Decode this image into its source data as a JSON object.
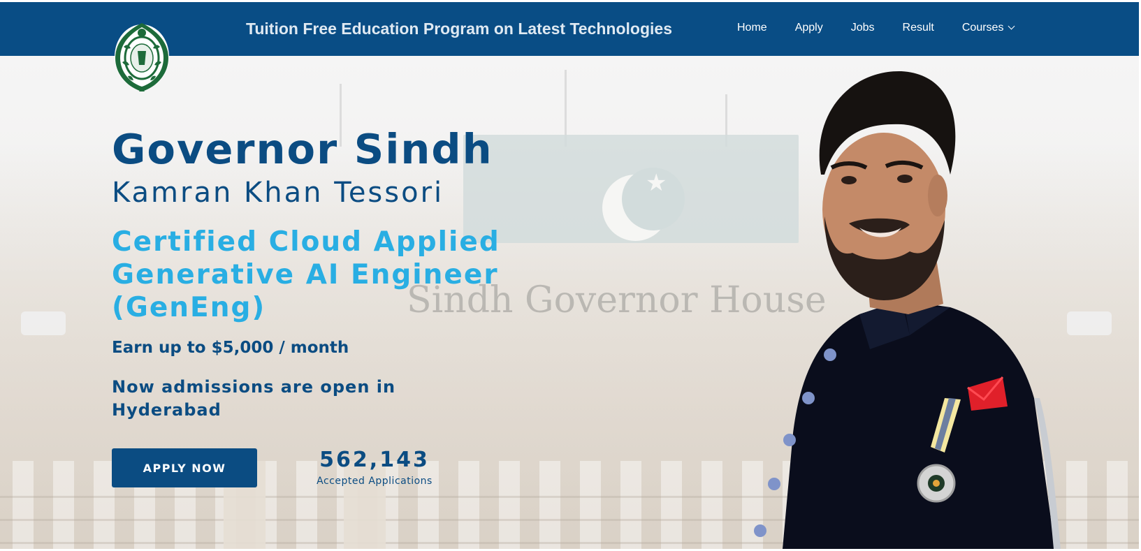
{
  "header": {
    "site_title": "Tuition Free Education Program on Latest Technologies",
    "nav": [
      {
        "label": "Home"
      },
      {
        "label": "Apply"
      },
      {
        "label": "Jobs"
      },
      {
        "label": "Result"
      },
      {
        "label": "Courses"
      }
    ],
    "logo": "governor-sindh-emblem"
  },
  "hero": {
    "title": "Governor Sindh",
    "subtitle": "Kamran Khan Tessori",
    "course_title": "Certified Cloud Applied Generative AI Engineer (GenEng)",
    "earning_text": "Earn up to $5,000 / month",
    "admissions_text": "Now admissions are open in Hyderabad",
    "apply_button_label": "APPLY NOW",
    "stats": {
      "value": "562,143",
      "label": "Accepted Applications"
    },
    "background_sign_text": "Sindh Governor House"
  },
  "colors": {
    "header_bg": "#094d85",
    "primary_text": "#0b4c82",
    "accent": "#29aee3",
    "button_bg": "#0b4c82"
  }
}
